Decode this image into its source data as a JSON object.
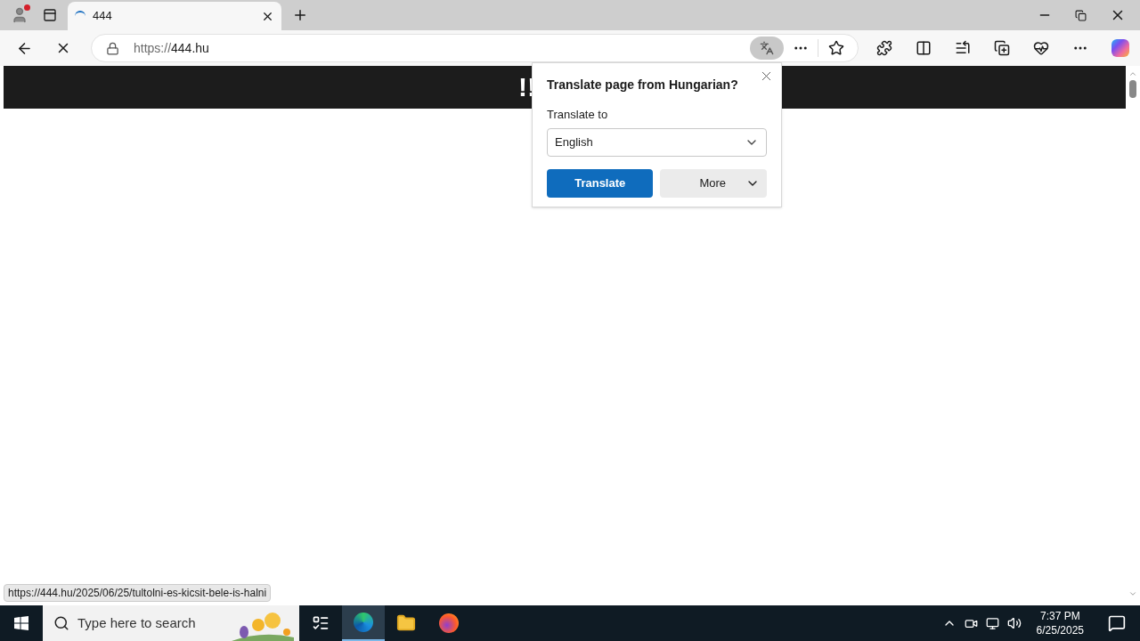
{
  "tab": {
    "title": "444",
    "selected": true
  },
  "address_bar": {
    "scheme": "https://",
    "host": "444.hu"
  },
  "page": {
    "banner_logo": "!!"
  },
  "translate_popup": {
    "title": "Translate page from Hungarian?",
    "label": "Translate to",
    "language": "English",
    "primary_button": "Translate",
    "secondary_button": "More"
  },
  "status_url": "https://444.hu/2025/06/25/tultolni-es-kicsit-bele-is-halni",
  "taskbar": {
    "search_placeholder": "Type here to search",
    "time": "7:37 PM",
    "date": "6/25/2025"
  }
}
